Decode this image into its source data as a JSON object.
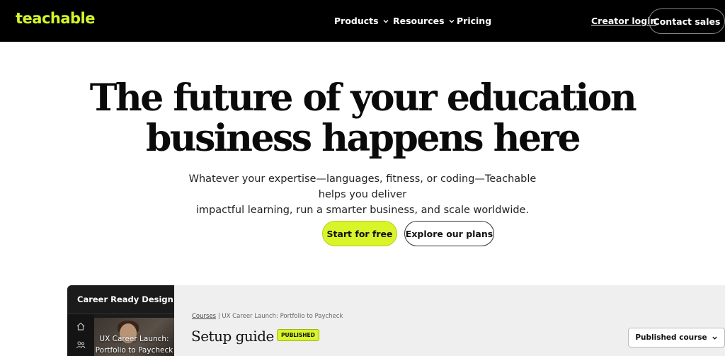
{
  "nav": {
    "logo": "teachable",
    "items": [
      {
        "label": "Products",
        "has_dropdown": true
      },
      {
        "label": "Resources",
        "has_dropdown": true
      },
      {
        "label": "Pricing",
        "has_dropdown": false
      }
    ],
    "login": "Creator login",
    "contact": "Contact sales"
  },
  "hero": {
    "title_line1": "The future of your education",
    "title_line2": "business happens here",
    "subtitle_line1": "Whatever your expertise—languages, fitness, or coding—Teachable helps you deliver",
    "subtitle_line2": "impactful learning, run a smarter business, and scale worldwide.",
    "primary_cta": "Start for free",
    "secondary_cta": "Explore our plans"
  },
  "preview": {
    "sidebar_title": "Career Ready Design",
    "thumb_line1": "UX Career Launch:",
    "thumb_line2": "Portfolio to Paycheck",
    "breadcrumb_link": "Courses",
    "breadcrumb_sep": "|",
    "breadcrumb_current": "UX Career Launch: Portfolio to Paycheck",
    "title": "Setup guide",
    "badge": "PUBLISHED",
    "status_select": "Published course"
  },
  "colors": {
    "brand_lime": "#d9f52a",
    "nav_bg": "#000000",
    "dark_sidebar": "#1b1b1b"
  },
  "icons": [
    "chevron-down-icon",
    "home-icon",
    "users-icon"
  ]
}
